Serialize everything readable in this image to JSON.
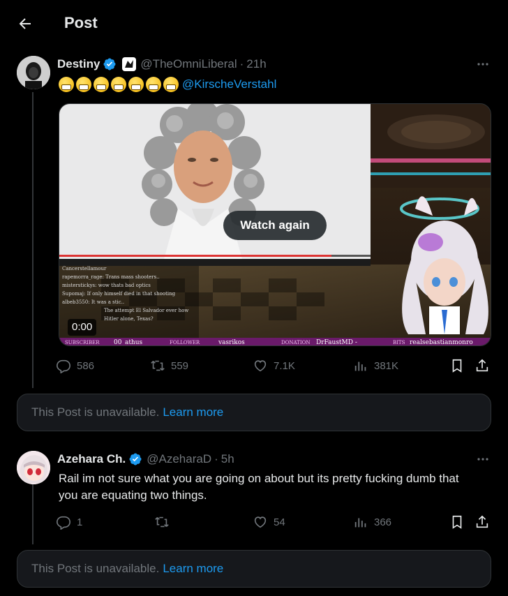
{
  "header": {
    "title": "Post"
  },
  "tweet": {
    "name": "Destiny",
    "handle": "@TheOmniLiberal",
    "time_sep": "·",
    "time": "21h",
    "mention": "@KirscheVerstahl",
    "emoji_count": 7,
    "video": {
      "overlay_label": "Watch again",
      "timestamp": "0:00",
      "ticker": [
        "SUBSCRIBER",
        "00_athus",
        "FOLLOWER",
        "vasrikos",
        "DONATION",
        "DrFaustMD -",
        "BITS",
        "realsebastianmonro"
      ],
      "chat_lines": [
        "Cancerstellamour",
        "rapemorra_rage: Trans mass shooters..",
        "misterstickys: wow thats bad optics",
        "Supomaj: If only        himself died in that shooting",
        "albeb3550: It was a stic..",
        "The attempt El Salvador ever how",
        "Hitler alone, Texas?"
      ]
    },
    "stats": {
      "replies": "586",
      "reposts": "559",
      "likes": "7.1K",
      "views": "381K"
    }
  },
  "unavailable_1": {
    "text": "This Post is unavailable.",
    "link": "Learn more"
  },
  "reply": {
    "name": "Azehara Ch.",
    "handle": "@AzeharaD",
    "time_sep": "·",
    "time": "5h",
    "text": "Rail im not sure what you are going on about but its pretty fucking dumb that you are equating two things.",
    "stats": {
      "replies": "1",
      "reposts": "",
      "likes": "54",
      "views": "366"
    }
  },
  "unavailable_2": {
    "text": "This Post is unavailable.",
    "link": "Learn more"
  },
  "colors": {
    "accent": "#1d9bf0",
    "muted": "#71767b",
    "text": "#e7e9ea",
    "card": "#16181c"
  }
}
